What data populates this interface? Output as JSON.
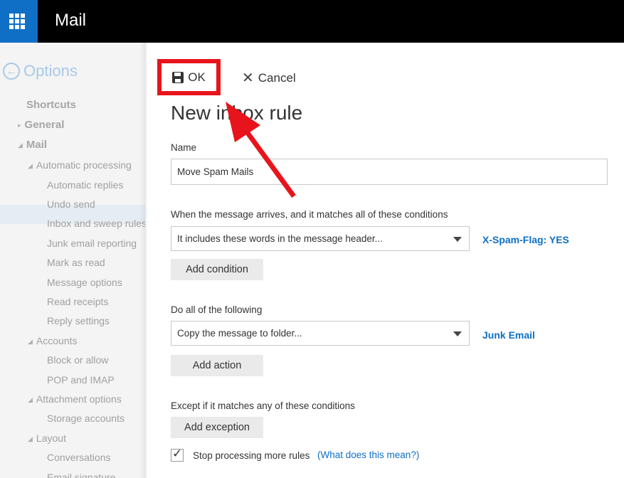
{
  "topbar": {
    "app_title": "Mail",
    "waffle_icon": "app-launcher-icon",
    "background": "#000000",
    "waffle_background": "#0f6fc6"
  },
  "sidebar": {
    "header": {
      "title": "Options",
      "icon": "back-arrow-icon"
    },
    "items": [
      {
        "label": "Shortcuts",
        "level": 1,
        "expander": ""
      },
      {
        "label": "General",
        "level": 1,
        "expander": "▸"
      },
      {
        "label": "Mail",
        "level": 1,
        "expander": "◢"
      },
      {
        "label": "Automatic processing",
        "level": 2,
        "expander": "◢"
      },
      {
        "label": "Automatic replies",
        "level": 3
      },
      {
        "label": "Undo send",
        "level": 3
      },
      {
        "label": "Inbox and sweep rules",
        "level": 3,
        "selected": true
      },
      {
        "label": "Junk email reporting",
        "level": 3
      },
      {
        "label": "Mark as read",
        "level": 3
      },
      {
        "label": "Message options",
        "level": 3
      },
      {
        "label": "Read receipts",
        "level": 3
      },
      {
        "label": "Reply settings",
        "level": 3
      },
      {
        "label": "Accounts",
        "level": 2,
        "expander": "◢"
      },
      {
        "label": "Block or allow",
        "level": 3
      },
      {
        "label": "POP and IMAP",
        "level": 3
      },
      {
        "label": "Attachment options",
        "level": 2,
        "expander": "◢"
      },
      {
        "label": "Storage accounts",
        "level": 3
      },
      {
        "label": "Layout",
        "level": 2,
        "expander": "◢"
      },
      {
        "label": "Conversations",
        "level": 3
      },
      {
        "label": "Email signature",
        "level": 3
      }
    ]
  },
  "toolbar": {
    "ok_label": "OK",
    "cancel_label": "Cancel",
    "highlight_color": "#e8141c"
  },
  "rule": {
    "page_title": "New inbox rule",
    "name_label": "Name",
    "name_value": "Move Spam Mails",
    "conditions_label": "When the message arrives, and it matches all of these conditions",
    "condition_value": "It includes these words in the message header...",
    "condition_link": "X-Spam-Flag: YES",
    "add_condition": "Add condition",
    "actions_label": "Do all of the following",
    "action_value": "Copy the message to folder...",
    "action_link": "Junk Email",
    "add_action": "Add action",
    "exceptions_label": "Except if it matches any of these conditions",
    "add_exception": "Add exception",
    "stop_processing_label": "Stop processing more rules",
    "stop_processing_checked": true,
    "help_open": "(",
    "help_link": "What does this mean?",
    "help_close": ")"
  },
  "colors": {
    "accent": "#0f6fc6",
    "annotation_red": "#e8141c"
  }
}
